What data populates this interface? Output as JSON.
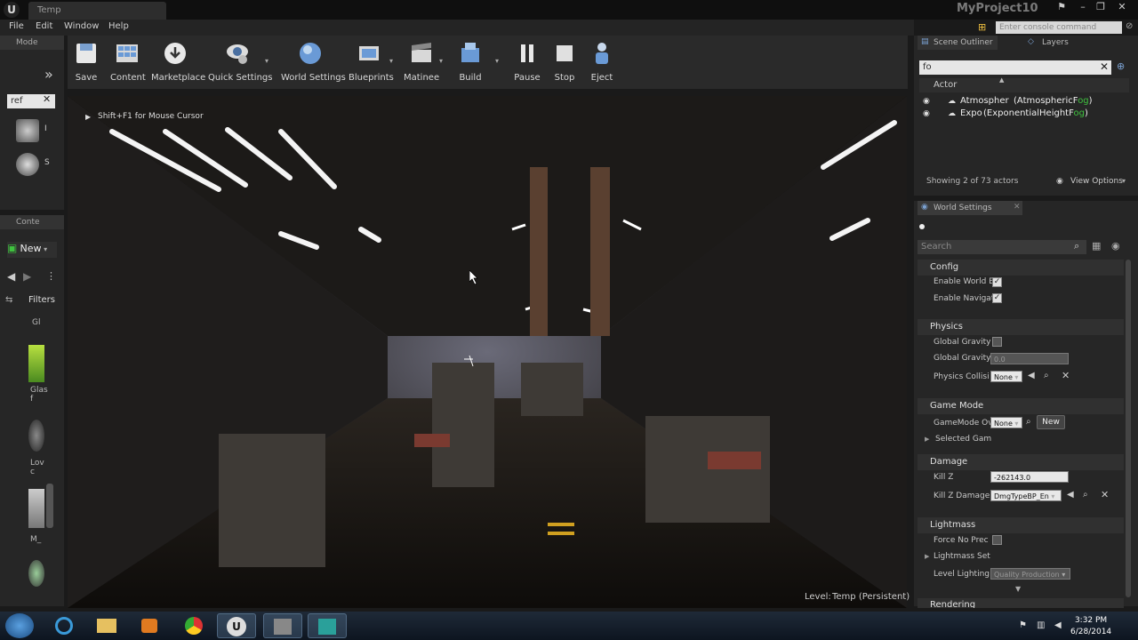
{
  "window": {
    "tab_title": "Temp",
    "project_name": "MyProject10",
    "console_placeholder": "Enter console command"
  },
  "menu": [
    "File",
    "Edit",
    "Window",
    "Help"
  ],
  "toolbar": [
    {
      "label": "Save",
      "icon": "save-icon"
    },
    {
      "label": "Content",
      "icon": "content-icon"
    },
    {
      "label": "Marketplace",
      "icon": "marketplace-icon"
    },
    {
      "label": "Quick Settings",
      "icon": "quick-settings-icon"
    },
    {
      "label": "World Settings",
      "icon": "world-settings-icon"
    },
    {
      "label": "Blueprints",
      "icon": "blueprints-icon"
    },
    {
      "label": "Matinee",
      "icon": "matinee-icon"
    },
    {
      "label": "Build",
      "icon": "build-icon"
    },
    {
      "label": "Pause",
      "icon": "pause-icon"
    },
    {
      "label": "Stop",
      "icon": "stop-icon"
    },
    {
      "label": "Eject",
      "icon": "eject-icon"
    }
  ],
  "modes": {
    "tab": "Mode",
    "search": "ref",
    "items": [
      "I",
      "S"
    ]
  },
  "content_browser": {
    "tab": "Conte",
    "new_label": "New",
    "filters_label": "Filters",
    "assets": [
      "Gl",
      "Glas f",
      "Lov c",
      "M_"
    ]
  },
  "viewport": {
    "hint": "Shift+F1 for Mouse Cursor",
    "level_label": "Level:",
    "level_value": "Temp (Persistent)"
  },
  "outliner": {
    "tab": "Scene Outliner",
    "tab2": "Layers",
    "search": "fo",
    "column": "Actor",
    "actors": [
      {
        "name": "Atmospher",
        "type_prefix": "(AtmosphericF",
        "type_match": "og",
        "type_suffix": ")"
      },
      {
        "name": "Expo",
        "type_prefix": "(ExponentialHeightF",
        "type_match": "og",
        "type_suffix": ")"
      }
    ],
    "count": "Showing 2 of 73 actors",
    "view_options": "View Options"
  },
  "world_settings": {
    "tab": "World Settings",
    "search_placeholder": "Search",
    "sections": {
      "config": "Config",
      "physics": "Physics",
      "game_mode": "Game Mode",
      "damage": "Damage",
      "lightmass": "Lightmass",
      "rendering": "Rendering"
    },
    "props": {
      "enable_world_b": "Enable World B",
      "enable_navig": "Enable Navigat",
      "global_gravity": "Global Gravity",
      "global_gravity2": "Global Gravity",
      "gravity_value": "0.0",
      "physics_collis": "Physics Collisi",
      "physics_collis_value": "None",
      "gamemode_ov": "GameMode Ov",
      "gamemode_value": "None",
      "new_button": "New",
      "selected_gam": "Selected Gam",
      "kill_z": "Kill Z",
      "kill_z_value": "-262143.0",
      "kill_z_damage": "Kill Z Damage",
      "kill_z_damage_value": "DmgTypeBP_En",
      "force_no_prec": "Force No Prec",
      "lightmass_set": "Lightmass Set",
      "level_lighting": "Level Lighting",
      "level_lighting_value": "Quality Production"
    }
  },
  "taskbar": {
    "time": "3:32 PM",
    "date": "6/28/2014"
  },
  "colors": {
    "accent_green": "#3fc13f",
    "panel": "#262626",
    "taskbar": "#0d1520"
  }
}
